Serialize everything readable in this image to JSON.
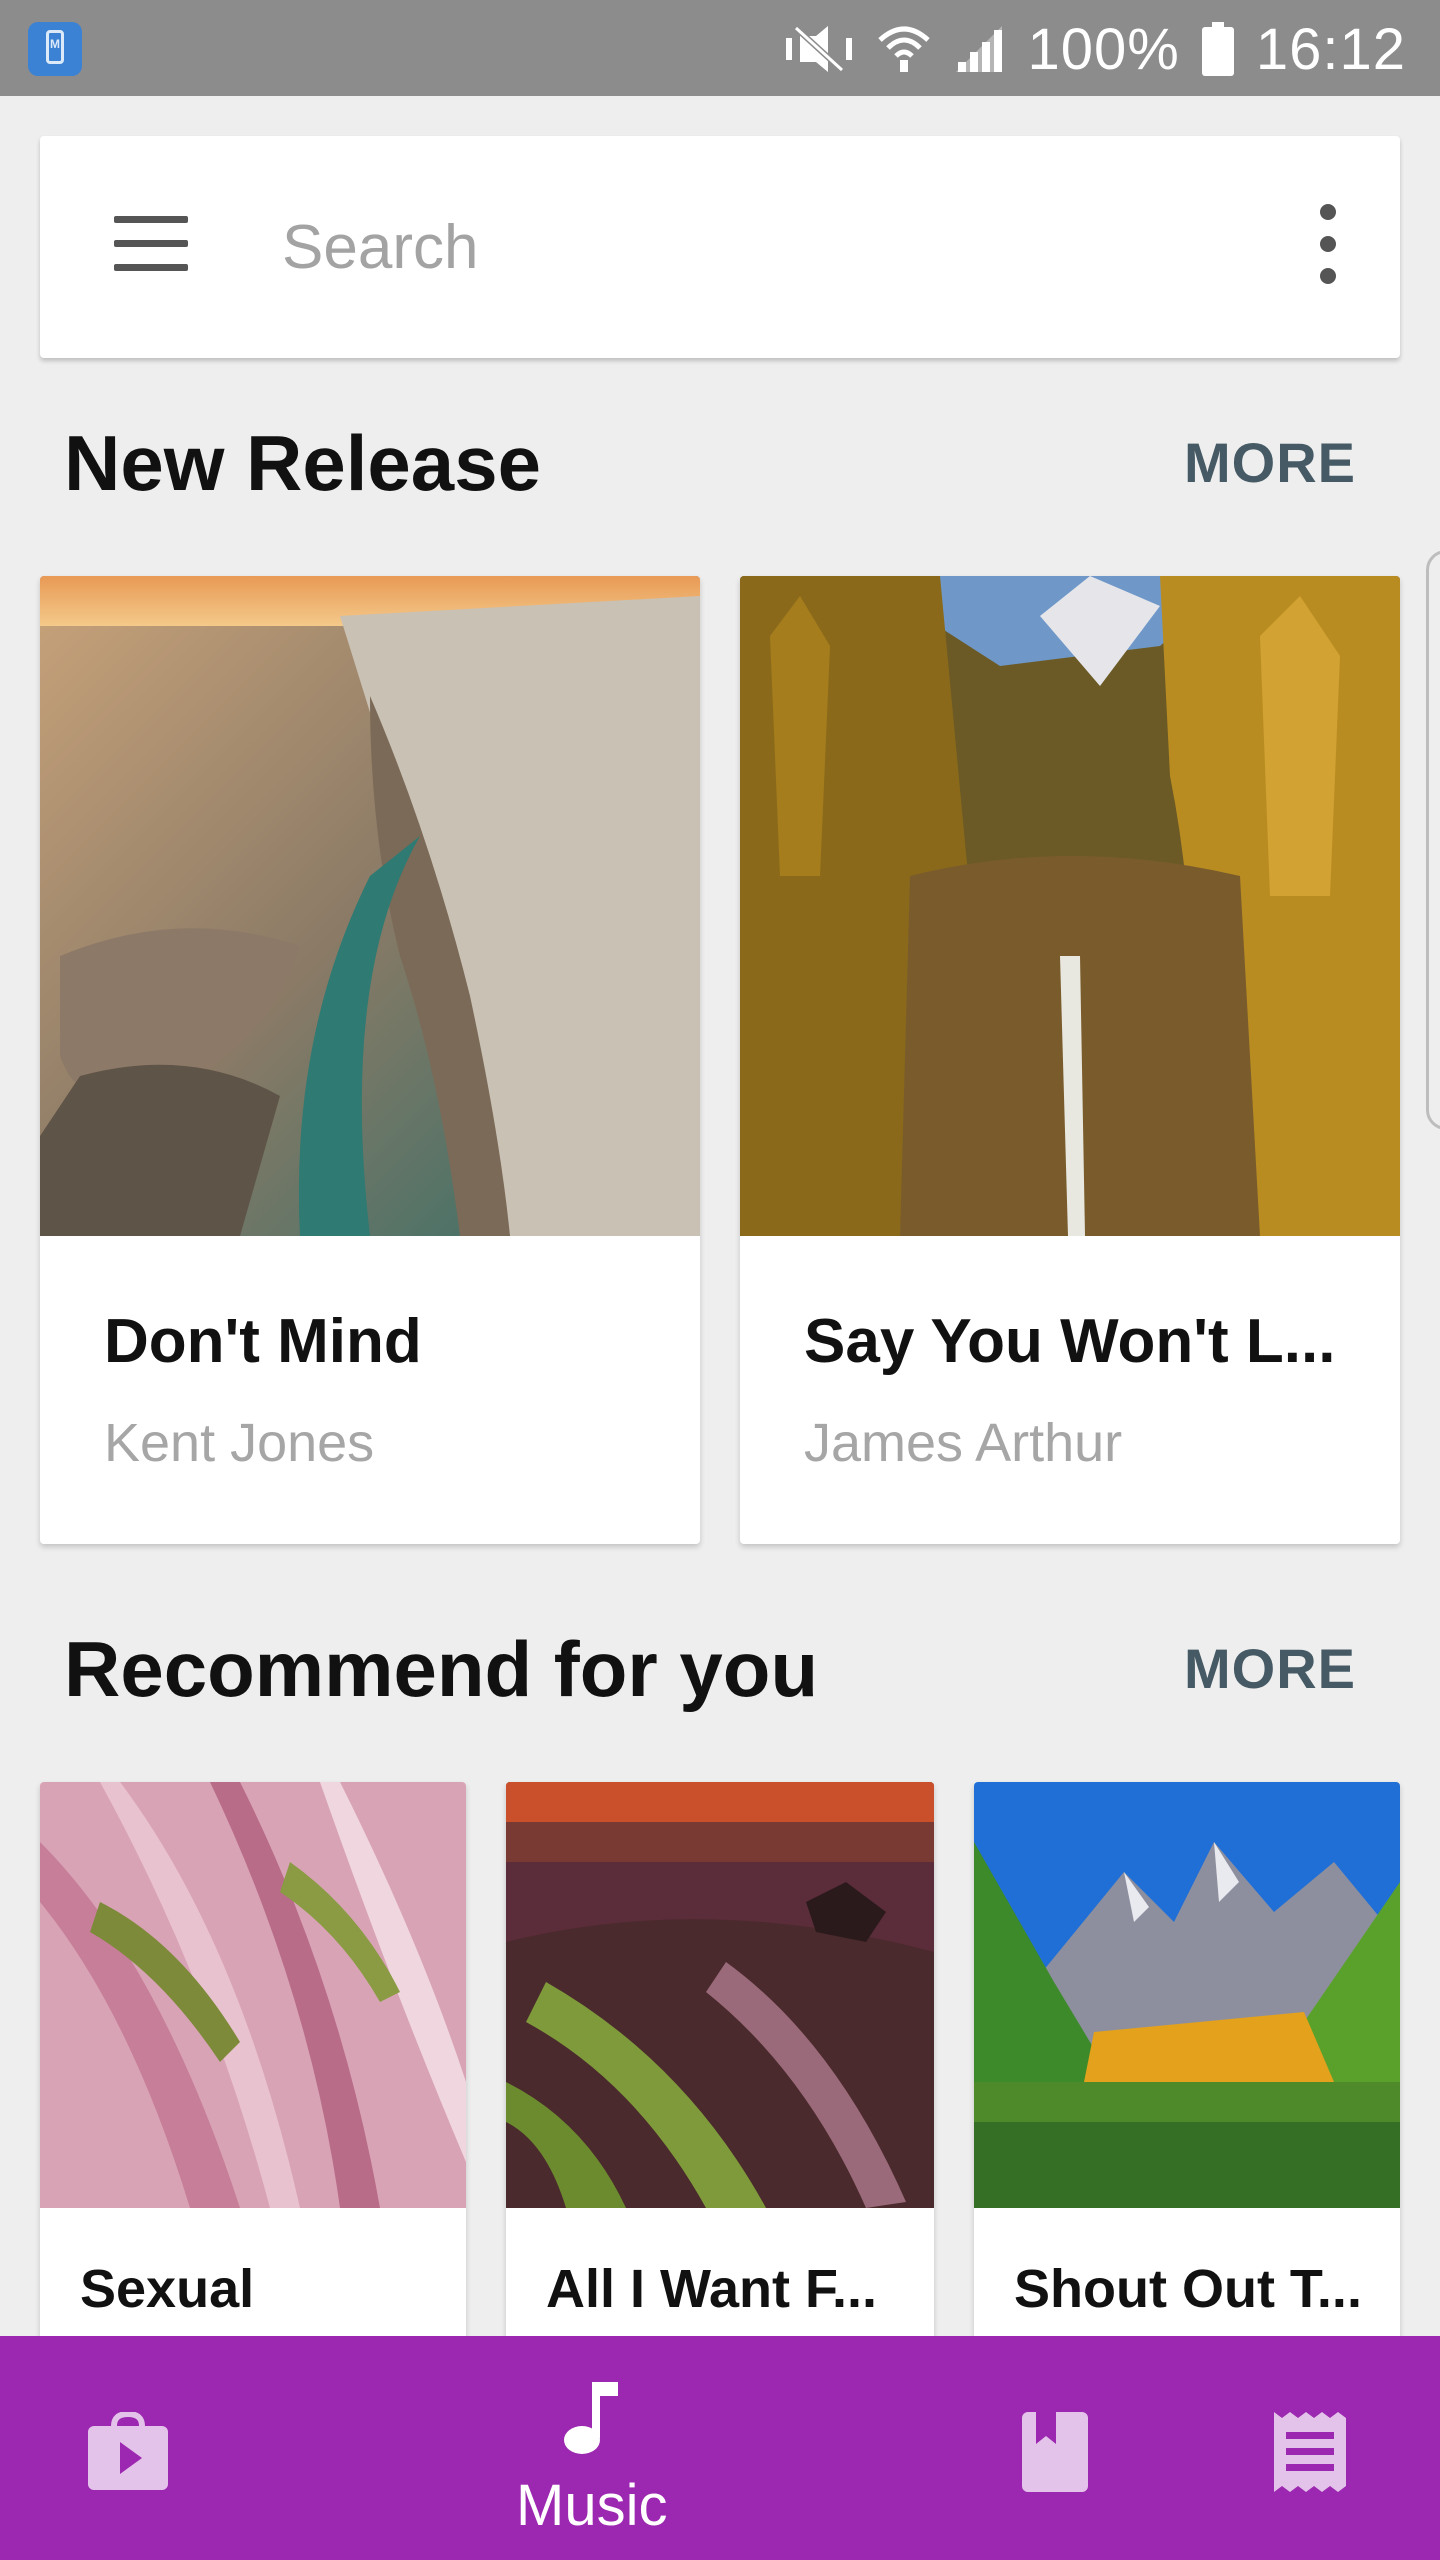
{
  "status_bar": {
    "battery": "100%",
    "time": "16:12"
  },
  "search": {
    "placeholder": "Search"
  },
  "new_release": {
    "title": "New Release",
    "more_label": "MORE",
    "items": [
      {
        "title": "Don't Mind",
        "artist": "Kent Jones"
      },
      {
        "title": "Say You Won't L...",
        "artist": "James Arthur"
      }
    ]
  },
  "recommend": {
    "title": "Recommend for you",
    "more_label": "MORE",
    "items": [
      {
        "title": "Sexual"
      },
      {
        "title": "All I Want F..."
      },
      {
        "title": "Shout Out T..."
      }
    ]
  },
  "bottom_nav": {
    "items": [
      {
        "icon": "play-store-bag-icon",
        "label": ""
      },
      {
        "icon": "music-note-icon",
        "label": "Music"
      },
      {
        "icon": "book-icon",
        "label": ""
      },
      {
        "icon": "receipt-icon",
        "label": ""
      }
    ],
    "active": "Music",
    "color": "#9c27b0"
  }
}
